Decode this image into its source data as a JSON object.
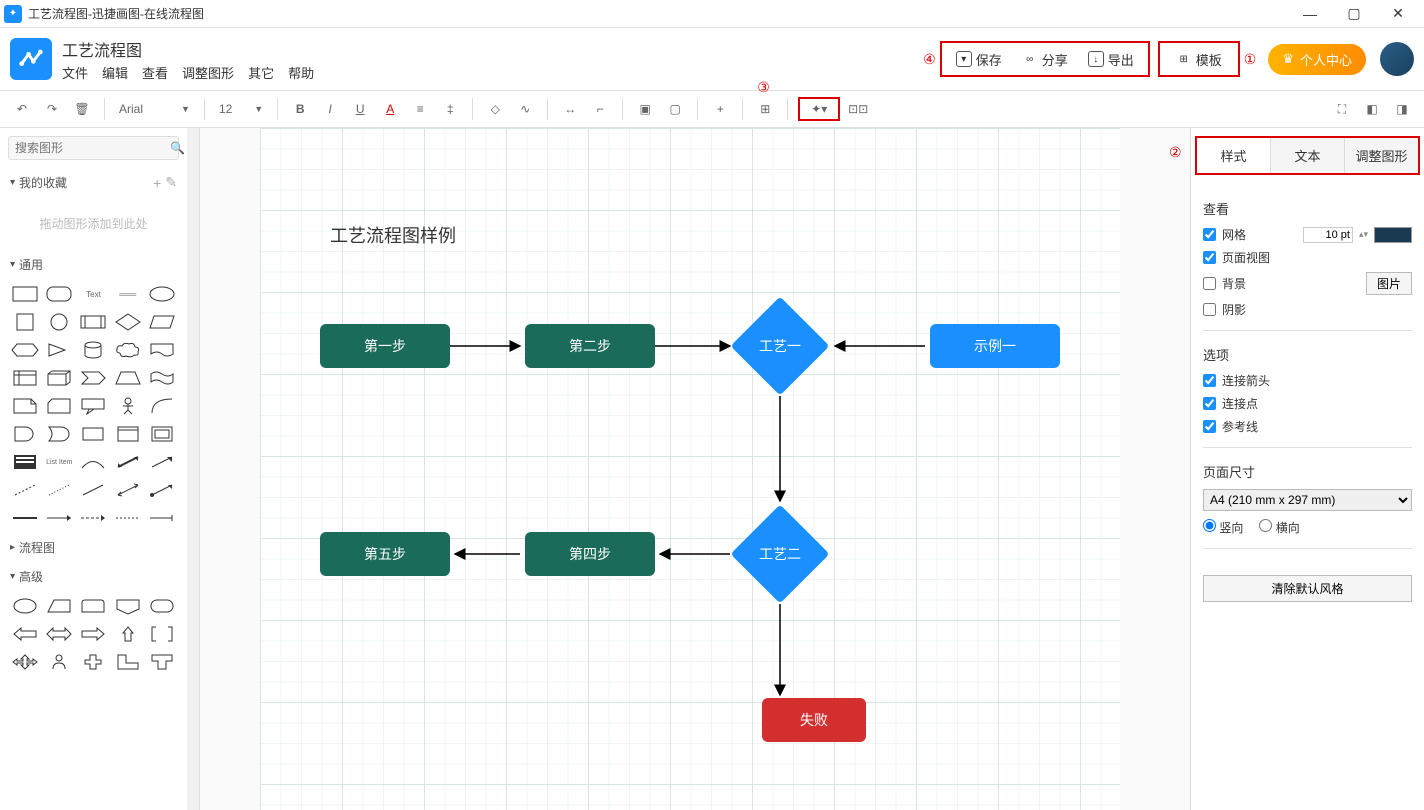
{
  "window_title": "工艺流程图-迅捷画图-在线流程图",
  "doc_title": "工艺流程图",
  "menus": [
    "文件",
    "编辑",
    "查看",
    "调整图形",
    "其它",
    "帮助"
  ],
  "top_buttons": {
    "save": "保存",
    "share": "分享",
    "export": "导出",
    "template": "模板",
    "user": "个人中心"
  },
  "toolbar": {
    "font": "Arial",
    "font_size": "12"
  },
  "search_placeholder": "搜索图形",
  "sections": {
    "fav": "我的收藏",
    "drop_hint": "拖动图形添加到此处",
    "general": "通用",
    "flow": "流程图",
    "advanced": "高级"
  },
  "canvas_title": "工艺流程图样例",
  "nodes": {
    "step1": "第一步",
    "step2": "第二步",
    "step4": "第四步",
    "step5": "第五步",
    "proc1": "工艺一",
    "proc2": "工艺二",
    "ex1": "示例一",
    "fail": "失败"
  },
  "tabs": [
    "样式",
    "文本",
    "调整图形"
  ],
  "props": {
    "view_title": "查看",
    "grid": "网格",
    "page_view": "页面视图",
    "background": "背景",
    "shadow": "阴影",
    "grid_size": "10 pt",
    "bg_btn": "图片",
    "options_title": "选项",
    "conn_arrow": "连接箭头",
    "conn_point": "连接点",
    "guide": "参考线",
    "page_size_title": "页面尺寸",
    "page_size": "A4 (210 mm x 297 mm)",
    "portrait": "竖向",
    "landscape": "横向",
    "clear_btn": "清除默认风格"
  },
  "annotations": {
    "a1": "①",
    "a2": "②",
    "a3": "③",
    "a4": "④"
  }
}
